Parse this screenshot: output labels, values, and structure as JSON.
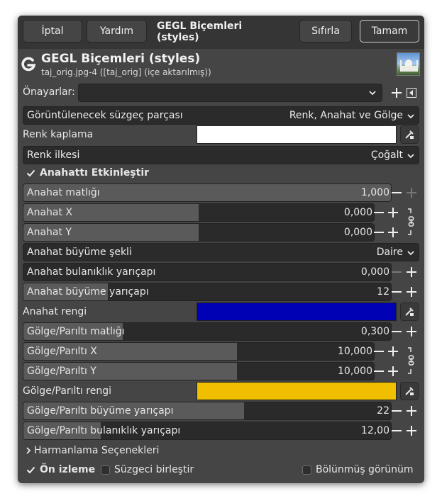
{
  "header": {
    "cancel_label": "İptal",
    "help_label": "Yardım",
    "title": "GEGL Biçemleri (styles)",
    "reset_label": "Sıfırla",
    "ok_label": "Tamam"
  },
  "filter": {
    "name": "GEGL Biçemleri (styles)",
    "image": "taj_orig.jpg-4 ([taj_orig] (içe aktarılmış))"
  },
  "presets": {
    "label": "Önayarlar:",
    "value": ""
  },
  "controls": {
    "part_label": "Görüntülenecek süzgeç parçası",
    "part_value": "Renk, Anahat ve Gölge",
    "color_overlay_label": "Renk kaplama",
    "color_overlay_color": "#ffffff",
    "blend_label": "Renk ilkesi",
    "blend_value": "Çoğalt",
    "enable_outline_label": "Anahattı Etkinleştir",
    "outline_opacity": {
      "label": "Anahat matlığı",
      "value": "1,000",
      "fraction": 1.0
    },
    "outline_x": {
      "label": "Anahat X",
      "value": "0,000",
      "fraction": 0.5
    },
    "outline_y": {
      "label": "Anahat Y",
      "value": "0,000",
      "fraction": 0.5
    },
    "grow_shape_label": "Anahat büyüme şekli",
    "grow_shape_value": "Daire",
    "outline_blur": {
      "label": "Anahat bulanıklık yarıçapı",
      "value": "0,000",
      "fraction": 0.0
    },
    "outline_grow": {
      "label": "Anahat büyüme yarıçapı",
      "value": "12",
      "fraction": 0.23
    },
    "outline_color_label": "Anahat rengi",
    "outline_color": "#0000b4",
    "shadow_opacity": {
      "label": "Gölge/Parıltı matlığı",
      "value": "0,300",
      "fraction": 0.27
    },
    "shadow_x": {
      "label": "Gölge/Parıltı X",
      "value": "10,000",
      "fraction": 0.61
    },
    "shadow_y": {
      "label": "Gölge/Parıltı Y",
      "value": "10,000",
      "fraction": 0.61
    },
    "shadow_color_label": "Gölge/Parıltı rengi",
    "shadow_color": "#f0c000",
    "shadow_grow": {
      "label": "Gölge/Parıltı büyüme yarıçapı",
      "value": "22",
      "fraction": 0.6
    },
    "shadow_blur": {
      "label": "Gölge/Parıltı bulanıklık yarıçapı",
      "value": "12,00",
      "fraction": 0.21
    },
    "blending_options_label": "Harmanlama Seçenekleri"
  },
  "footer": {
    "preview_label": "Ön izleme",
    "merge_label": "Süzgeci birleştir",
    "split_label": "Bölünmüş görünüm"
  },
  "icons": {
    "gegl": "gegl-logo-icon",
    "add_preset": "plus-icon",
    "preset_menu": "menu-arrow-icon",
    "picker": "color-picker-icon",
    "chain": "chain-link-icon"
  }
}
